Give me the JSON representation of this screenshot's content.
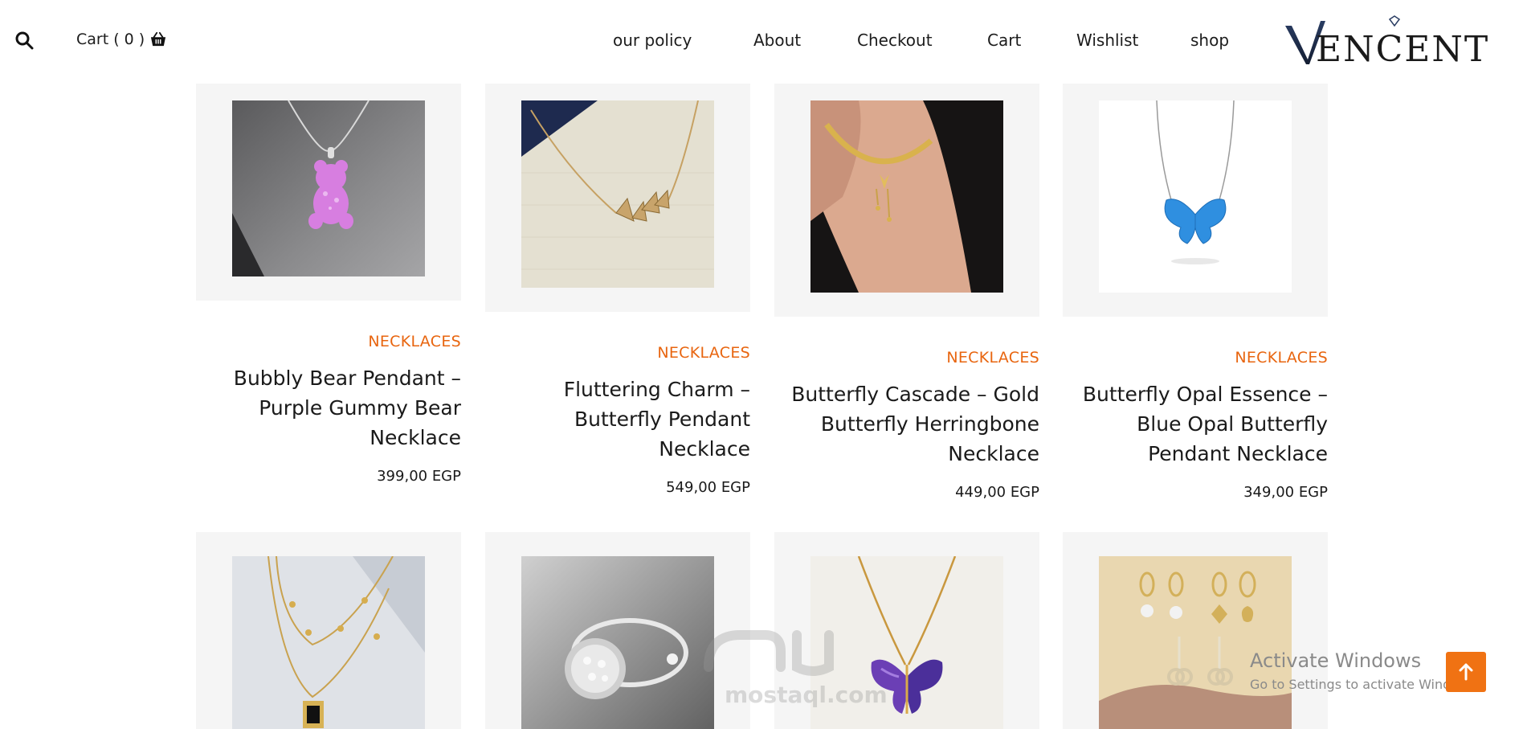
{
  "header": {
    "cart_label": "Cart ( 0 )",
    "nav": [
      "our policy",
      "About",
      "Checkout",
      "Cart",
      "Wishlist",
      "shop"
    ],
    "logo_text": "VENCENT",
    "icons": {
      "search": "search-icon",
      "cart": "basket-icon",
      "logo_gem": "diamond-icon"
    }
  },
  "products": [
    {
      "category": "NECKLACES",
      "title": "Bubbly Bear Pendant – Purple Gummy Bear Necklace",
      "price": "399,00 EGP"
    },
    {
      "category": "NECKLACES",
      "title": "Fluttering Charm – Butterfly Pendant Necklace",
      "price": "549,00 EGP"
    },
    {
      "category": "NECKLACES",
      "title": "Butterfly Cascade – Gold Butterfly Herringbone Necklace",
      "price": "449,00 EGP"
    },
    {
      "category": "NECKLACES",
      "title": "Butterfly Opal Essence – Blue Opal Butterfly Pendant Necklace",
      "price": "349,00 EGP"
    }
  ],
  "overlay": {
    "activate_title": "Activate Windows",
    "activate_subtitle": "Go to Settings to activate Windows.",
    "watermark": "mostaql.com",
    "scroll_top_icon": "arrow-up-icon"
  },
  "colors": {
    "accent": "#e8650f",
    "button": "#f07213",
    "card_bg": "#f5f5f5",
    "logo_navy": "#1d2b4a"
  }
}
